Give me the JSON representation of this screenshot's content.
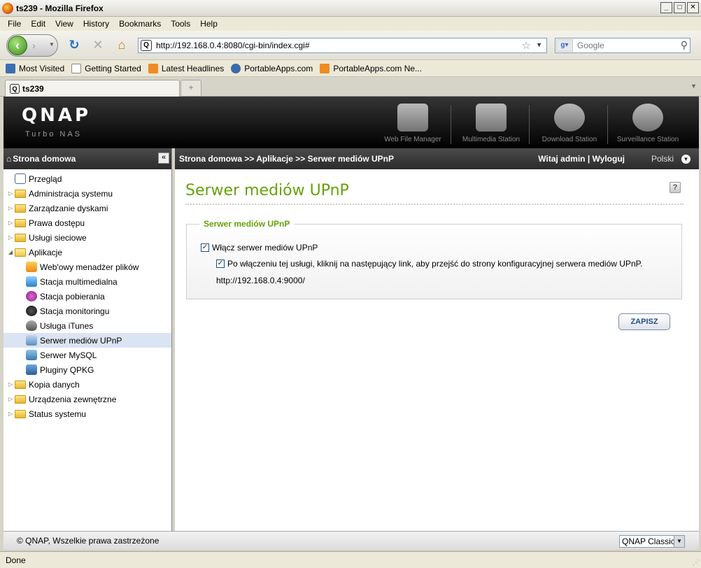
{
  "window": {
    "title": "ts239 - Mozilla Firefox"
  },
  "menubar": {
    "items": [
      "File",
      "Edit",
      "View",
      "History",
      "Bookmarks",
      "Tools",
      "Help"
    ]
  },
  "toolbar": {
    "url": "http://192.168.0.4:8080/cgi-bin/index.cgi#",
    "search_placeholder": "Google"
  },
  "bookmarks": [
    "Most Visited",
    "Getting Started",
    "Latest Headlines",
    "PortableApps.com",
    "PortableApps.com Ne..."
  ],
  "tab": {
    "label": "ts239"
  },
  "qnap": {
    "logo": "QNAP",
    "subtitle": "Turbo NAS",
    "apps": [
      "Web File Manager",
      "Multimedia Station",
      "Download Station",
      "Surveillance Station"
    ]
  },
  "sidebar": {
    "header": "Strona domowa",
    "items": [
      {
        "label": "Przegląd"
      },
      {
        "label": "Administracja systemu"
      },
      {
        "label": "Zarządzanie dyskami"
      },
      {
        "label": "Prawa dostępu"
      },
      {
        "label": "Usługi sieciowe"
      },
      {
        "label": "Aplikacje"
      },
      {
        "label": "Web'owy menadżer plików"
      },
      {
        "label": "Stacja multimedialna"
      },
      {
        "label": "Stacja pobierania"
      },
      {
        "label": "Stacja monitoringu"
      },
      {
        "label": "Usługa iTunes"
      },
      {
        "label": "Serwer mediów UPnP"
      },
      {
        "label": "Serwer MySQL"
      },
      {
        "label": "Pluginy QPKG"
      },
      {
        "label": "Kopia danych"
      },
      {
        "label": "Urządzenia zewnętrzne"
      },
      {
        "label": "Status systemu"
      }
    ]
  },
  "main": {
    "breadcrumb": "Strona domowa >> Aplikacje >> Serwer mediów UPnP",
    "welcome": "Witaj admin",
    "logout": "Wyloguj",
    "language": "Polski",
    "page_title": "Serwer mediów UPnP",
    "section_title": "Serwer mediów UPnP",
    "enable_label": "Włącz serwer mediów UPnP",
    "enable_checked": true,
    "info_label": "Po włączeniu tej usługi, kliknij na następujący link, aby przejść do strony konfiguracyjnej serwera mediów UPnP.",
    "info_checked": true,
    "link": "http://192.168.0.4:9000/",
    "save_label": "ZAPISZ"
  },
  "footer": {
    "copyright": "© QNAP, Wszelkie prawa zastrzeżone",
    "theme": "QNAP Classic"
  },
  "status": {
    "text": "Done"
  },
  "colors": {
    "accent_green": "#66a20a",
    "header_dark": "#2b2b2b",
    "selected_bg": "#dbe4f3"
  }
}
